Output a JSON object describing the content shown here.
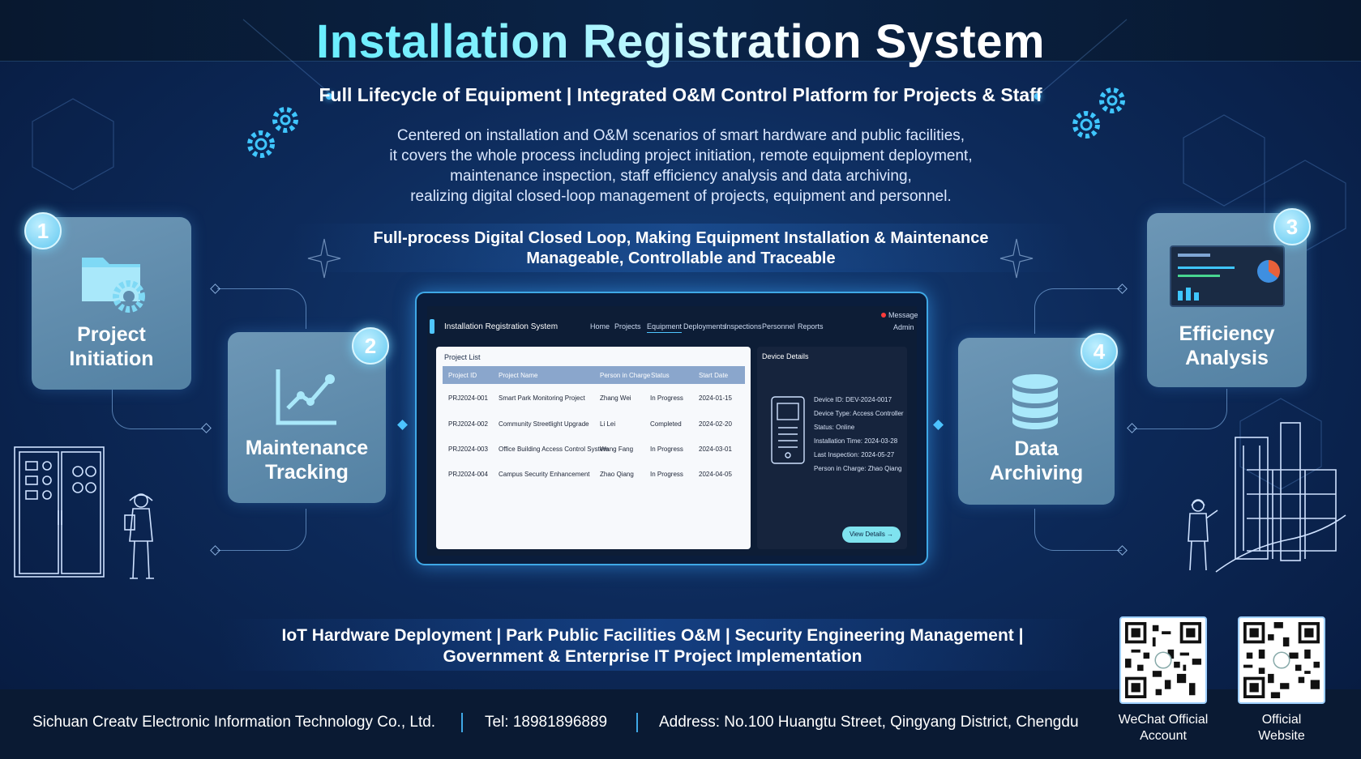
{
  "header": {
    "title": "Installation Registration System",
    "subtitle": "Full Lifecycle of Equipment | Integrated O&M Control Platform for Projects & Staff",
    "description": [
      "Centered on installation and O&M scenarios of smart hardware and public facilities,",
      "it covers the whole process including project initiation, remote equipment deployment,",
      "maintenance inspection, staff efficiency analysis and data archiving,",
      "realizing digital closed-loop management of projects, equipment and personnel."
    ],
    "tagline": [
      "Full-process Digital Closed Loop, Making Equipment Installation & Maintenance",
      "Manageable, Controllable and Traceable"
    ]
  },
  "modules": [
    {
      "number": "1",
      "label_line1": "Project",
      "label_line2": "Initiation",
      "icon": "folder-gear-icon"
    },
    {
      "number": "2",
      "label_line1": "Maintenance",
      "label_line2": "Tracking",
      "icon": "line-chart-icon"
    },
    {
      "number": "3",
      "label_line1": "Efficiency",
      "label_line2": "Analysis",
      "icon": "dashboard-icon"
    },
    {
      "number": "4",
      "label_line1": "Data",
      "label_line2": "Archiving",
      "icon": "database-icon"
    }
  ],
  "app": {
    "title": "Installation Registration System",
    "nav": [
      "Home",
      "Projects",
      "Equipment",
      "Deployments",
      "Inspections",
      "Personnel",
      "Reports"
    ],
    "active_nav": "Equipment",
    "message": "Message",
    "user": "Admin",
    "project_list": {
      "title": "Project List",
      "columns": [
        "Project ID",
        "Project Name",
        "Person in Charge",
        "Status",
        "Start Date"
      ],
      "rows": [
        [
          "PRJ2024-001",
          "Smart Park Monitoring Project",
          "Zhang Wei",
          "In Progress",
          "2024-01-15"
        ],
        [
          "PRJ2024-002",
          "Community Streetlight Upgrade",
          "Li Lei",
          "Completed",
          "2024-02-20"
        ],
        [
          "PRJ2024-003",
          "Office Building Access Control System",
          "Wang Fang",
          "In Progress",
          "2024-03-01"
        ],
        [
          "PRJ2024-004",
          "Campus Security Enhancement",
          "Zhao Qiang",
          "In Progress",
          "2024-04-05"
        ]
      ]
    },
    "device_details": {
      "title": "Device Details",
      "lines": [
        "Device ID:  DEV-2024-0017",
        "Device Type: Access Controller",
        "Status: Online",
        "Installation Time: 2024-03-28",
        "Last Inspection: 2024-05-27",
        "Person in Charge: Zhao Qiang"
      ],
      "button": "View Details →"
    }
  },
  "scenarios": [
    "IoT Hardware Deployment | Park Public Facilities O&M | Security Engineering Management |",
    "Government & Enterprise IT Project Implementation"
  ],
  "footer": {
    "company": "Sichuan Creatv Electronic Information Technology Co., Ltd.",
    "tel": "Tel: 18981896889",
    "address": "Address: No.100 Huangtu Street, Qingyang District, Chengdu",
    "qr1_line1": "WeChat Official",
    "qr1_line2": "Account",
    "qr2_line1": "Official",
    "qr2_line2": "Website"
  },
  "colors": {
    "accent": "#4fc6ff",
    "card": "#5f8cae",
    "background": "#0d2a5a",
    "frame": "#3fa8e6"
  }
}
